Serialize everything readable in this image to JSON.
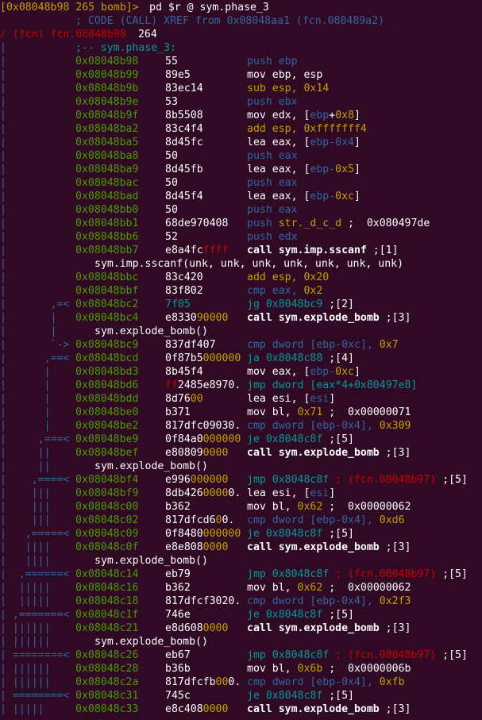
{
  "colors": {
    "background": "#300a24",
    "graph": "#3465a4",
    "address": "#4e9a06",
    "text": "#ffffff",
    "yellow": "#c4a000",
    "blue": "#3465a4",
    "red": "#cc0000",
    "cyan": "#06989a"
  },
  "prompt": {
    "address": "[0x08048b98 265 bomb]> ",
    "command": "pd $r @ sym.phase_3"
  },
  "header": {
    "xref": "; CODE (CALL) XREF from 0x08048aa1 (fcn.080489a2)",
    "fcn_prefix": "/ (fcn) fcn.08048b98",
    "fcn_size": " 264",
    "label": ";-- sym.phase_3:"
  },
  "lines": [
    {
      "graph": "|",
      "address": "0x08048b98",
      "bytes": [
        {
          "t": "55",
          "c": "plain"
        }
      ],
      "mnemonic": [
        {
          "t": "push ebp",
          "c": "blue"
        }
      ]
    },
    {
      "graph": "|",
      "address": "0x08048b99",
      "bytes": [
        {
          "t": "89e5",
          "c": "plain"
        }
      ],
      "mnemonic": [
        {
          "t": "mov ebp, esp",
          "c": "plain"
        }
      ]
    },
    {
      "graph": "|",
      "address": "0x08048b9b",
      "bytes": [
        {
          "t": "83ec14",
          "c": "plain"
        }
      ],
      "mnemonic": [
        {
          "t": "sub esp, ",
          "c": "yel"
        },
        {
          "t": "0x14",
          "c": "yel"
        }
      ]
    },
    {
      "graph": "|",
      "address": "0x08048b9e",
      "bytes": [
        {
          "t": "53",
          "c": "plain"
        }
      ],
      "mnemonic": [
        {
          "t": "push ebx",
          "c": "blue"
        }
      ]
    },
    {
      "graph": "|",
      "address": "0x08048b9f",
      "bytes": [
        {
          "t": "8b5508",
          "c": "plain"
        }
      ],
      "mnemonic": [
        {
          "t": "mov edx, [",
          "c": "plain"
        },
        {
          "t": "ebp",
          "c": "blue"
        },
        {
          "t": "+",
          "c": "plain"
        },
        {
          "t": "0x8",
          "c": "yel"
        },
        {
          "t": "]",
          "c": "plain"
        }
      ]
    },
    {
      "graph": "|",
      "address": "0x08048ba2",
      "bytes": [
        {
          "t": "83c4f4",
          "c": "plain"
        }
      ],
      "mnemonic": [
        {
          "t": "add esp, 0xfffffff4",
          "c": "yel"
        }
      ]
    },
    {
      "graph": "|",
      "address": "0x08048ba5",
      "bytes": [
        {
          "t": "8d45fc",
          "c": "plain"
        }
      ],
      "mnemonic": [
        {
          "t": "lea eax, [",
          "c": "plain"
        },
        {
          "t": "ebp-0x4",
          "c": "blue"
        },
        {
          "t": "]",
          "c": "plain"
        }
      ]
    },
    {
      "graph": "|",
      "address": "0x08048ba8",
      "bytes": [
        {
          "t": "50",
          "c": "plain"
        }
      ],
      "mnemonic": [
        {
          "t": "push eax",
          "c": "blue"
        }
      ]
    },
    {
      "graph": "|",
      "address": "0x08048ba9",
      "bytes": [
        {
          "t": "8d45fb",
          "c": "plain"
        }
      ],
      "mnemonic": [
        {
          "t": "lea eax, [",
          "c": "plain"
        },
        {
          "t": "ebp-",
          "c": "blue"
        },
        {
          "t": "0x5",
          "c": "yel"
        },
        {
          "t": "]",
          "c": "plain"
        }
      ]
    },
    {
      "graph": "|",
      "address": "0x08048bac",
      "bytes": [
        {
          "t": "50",
          "c": "plain"
        }
      ],
      "mnemonic": [
        {
          "t": "push eax",
          "c": "blue"
        }
      ]
    },
    {
      "graph": "|",
      "address": "0x08048bad",
      "bytes": [
        {
          "t": "8d45f4",
          "c": "plain"
        }
      ],
      "mnemonic": [
        {
          "t": "lea eax, [",
          "c": "plain"
        },
        {
          "t": "ebp-",
          "c": "blue"
        },
        {
          "t": "0xc",
          "c": "yel"
        },
        {
          "t": "]",
          "c": "plain"
        }
      ]
    },
    {
      "graph": "|",
      "address": "0x08048bb0",
      "bytes": [
        {
          "t": "50",
          "c": "plain"
        }
      ],
      "mnemonic": [
        {
          "t": "push eax",
          "c": "blue"
        }
      ]
    },
    {
      "graph": "|",
      "address": "0x08048bb1",
      "bytes": [
        {
          "t": "68de970408",
          "c": "plain"
        }
      ],
      "mnemonic": [
        {
          "t": "push ",
          "c": "blue"
        },
        {
          "t": "str._d_c_d",
          "c": "yel"
        },
        {
          "t": " ;  0x080497de",
          "c": "plain"
        }
      ]
    },
    {
      "graph": "|",
      "address": "0x08048bb6",
      "bytes": [
        {
          "t": "52",
          "c": "plain"
        }
      ],
      "mnemonic": [
        {
          "t": "push edx",
          "c": "blue"
        }
      ]
    },
    {
      "graph": "|",
      "address": "0x08048bb7",
      "bytes": [
        {
          "t": "e8a4fc",
          "c": "plain"
        },
        {
          "t": "ffff",
          "c": "red"
        }
      ],
      "mnemonic": [
        {
          "t": "call sym.imp.sscanf",
          "c": "bold"
        },
        {
          "t": " ;[1]",
          "c": "plain"
        }
      ]
    },
    {
      "graph": "|",
      "sub": "sym.imp.sscanf(unk, unk, unk, unk, unk, unk, unk)"
    },
    {
      "graph": "|",
      "address": "0x08048bbc",
      "bytes": [
        {
          "t": "83c420",
          "c": "plain"
        }
      ],
      "mnemonic": [
        {
          "t": "add esp, 0x20",
          "c": "yel"
        }
      ]
    },
    {
      "graph": "|",
      "address": "0x08048bbf",
      "bytes": [
        {
          "t": "83f802",
          "c": "plain"
        }
      ],
      "mnemonic": [
        {
          "t": "cmp eax, ",
          "c": "blue"
        },
        {
          "t": "0x2",
          "c": "yel"
        }
      ]
    },
    {
      "graph": "|       ,=<",
      "address": "0x08048bc2",
      "bytes": [
        {
          "t": "7f05",
          "c": "cyan"
        }
      ],
      "mnemonic": [
        {
          "t": "jg 0x8048bc9",
          "c": "cyan"
        },
        {
          "t": " ;[2]",
          "c": "plain"
        }
      ]
    },
    {
      "graph": "|       |",
      "address": "0x08048bc4",
      "bytes": [
        {
          "t": "e8330",
          "c": "plain"
        },
        {
          "t": "90000",
          "c": "yel"
        }
      ],
      "mnemonic": [
        {
          "t": "call sym.explode_bomb",
          "c": "bold"
        },
        {
          "t": " ;[3]",
          "c": "plain"
        }
      ]
    },
    {
      "graph": "|       |",
      "sub": "sym.explode_bomb()"
    },
    {
      "graph": "|       `->",
      "address": "0x08048bc9",
      "bytes": [
        {
          "t": "837df407",
          "c": "plain"
        }
      ],
      "mnemonic": [
        {
          "t": "cmp dword [",
          "c": "blue"
        },
        {
          "t": "ebp-0xc",
          "c": "blue"
        },
        {
          "t": "], ",
          "c": "blue"
        },
        {
          "t": "0x7",
          "c": "yel"
        }
      ]
    },
    {
      "graph": "|      ,==<",
      "address": "0x08048bcd",
      "bytes": [
        {
          "t": "0f87b5",
          "c": "plain"
        },
        {
          "t": "000000",
          "c": "yel"
        }
      ],
      "mnemonic": [
        {
          "t": "ja 0x8048c88",
          "c": "cyan"
        },
        {
          "t": " ;[4]",
          "c": "plain"
        }
      ]
    },
    {
      "graph": "|      |",
      "address": "0x08048bd3",
      "bytes": [
        {
          "t": "8b45f4",
          "c": "plain"
        }
      ],
      "mnemonic": [
        {
          "t": "mov eax, [",
          "c": "plain"
        },
        {
          "t": "ebp-",
          "c": "blue"
        },
        {
          "t": "0xc",
          "c": "yel"
        },
        {
          "t": "]",
          "c": "plain"
        }
      ]
    },
    {
      "graph": "|      |",
      "address": "0x08048bd6",
      "bytes": [
        {
          "t": "ff",
          "c": "red"
        },
        {
          "t": "2485e8970.",
          "c": "plain"
        }
      ],
      "mnemonic": [
        {
          "t": "jmp dword [eax*4+0x80497e8]",
          "c": "cyan"
        }
      ]
    },
    {
      "graph": "|      |",
      "address": "0x08048bdd",
      "bytes": [
        {
          "t": "8d76",
          "c": "plain"
        },
        {
          "t": "00",
          "c": "yel"
        }
      ],
      "mnemonic": [
        {
          "t": "lea esi, [",
          "c": "plain"
        },
        {
          "t": "esi",
          "c": "blue"
        },
        {
          "t": "]",
          "c": "plain"
        }
      ]
    },
    {
      "graph": "|      |",
      "address": "0x08048be0",
      "bytes": [
        {
          "t": "b371",
          "c": "plain"
        }
      ],
      "mnemonic": [
        {
          "t": "mov bl, ",
          "c": "plain"
        },
        {
          "t": "0x71",
          "c": "yel"
        },
        {
          "t": " ;  0x00000071",
          "c": "plain"
        }
      ]
    },
    {
      "graph": "|      |",
      "address": "0x08048be2",
      "bytes": [
        {
          "t": "817dfc09030.",
          "c": "plain"
        }
      ],
      "mnemonic": [
        {
          "t": "cmp dword [",
          "c": "blue"
        },
        {
          "t": "ebp-0x4",
          "c": "blue"
        },
        {
          "t": "], ",
          "c": "blue"
        },
        {
          "t": "0x309",
          "c": "yel"
        }
      ]
    },
    {
      "graph": "|     ,===<",
      "address": "0x08048be9",
      "bytes": [
        {
          "t": "0f84a0",
          "c": "plain"
        },
        {
          "t": "000000",
          "c": "yel"
        }
      ],
      "mnemonic": [
        {
          "t": "je 0x8048c8f",
          "c": "cyan"
        },
        {
          "t": " ;[5]",
          "c": "plain"
        }
      ]
    },
    {
      "graph": "|     ||",
      "address": "0x08048bef",
      "bytes": [
        {
          "t": "e80809",
          "c": "plain"
        },
        {
          "t": "0000",
          "c": "yel"
        }
      ],
      "mnemonic": [
        {
          "t": "call sym.explode_bomb",
          "c": "bold"
        },
        {
          "t": " ;[3]",
          "c": "plain"
        }
      ]
    },
    {
      "graph": "|     ||",
      "sub": "sym.explode_bomb()"
    },
    {
      "graph": "|    ,====<",
      "address": "0x08048bf4",
      "bytes": [
        {
          "t": "e996",
          "c": "plain"
        },
        {
          "t": "000000",
          "c": "yel"
        }
      ],
      "mnemonic": [
        {
          "t": "jmp 0x8048c8f",
          "c": "cyan"
        },
        {
          "t": " ; (fcn.08048b97)",
          "c": "red"
        },
        {
          "t": " ;[5]",
          "c": "plain"
        }
      ]
    },
    {
      "graph": "|    |||",
      "address": "0x08048bf9",
      "bytes": [
        {
          "t": "8db426",
          "c": "plain"
        },
        {
          "t": "0000",
          "c": "yel"
        },
        {
          "t": "0.",
          "c": "plain"
        }
      ],
      "mnemonic": [
        {
          "t": "lea esi, [",
          "c": "plain"
        },
        {
          "t": "esi",
          "c": "blue"
        },
        {
          "t": "]",
          "c": "plain"
        }
      ]
    },
    {
      "graph": "|    |||",
      "address": "0x08048c00",
      "bytes": [
        {
          "t": "b362",
          "c": "plain"
        }
      ],
      "mnemonic": [
        {
          "t": "mov bl, ",
          "c": "plain"
        },
        {
          "t": "0x62",
          "c": "yel"
        },
        {
          "t": " ;  0x00000062",
          "c": "plain"
        }
      ]
    },
    {
      "graph": "|    |||",
      "address": "0x08048c02",
      "bytes": [
        {
          "t": "817dfcd6",
          "c": "plain"
        },
        {
          "t": "0",
          "c": "yel"
        },
        {
          "t": "0.",
          "c": "plain"
        }
      ],
      "mnemonic": [
        {
          "t": "cmp dword [",
          "c": "blue"
        },
        {
          "t": "ebp-0x4",
          "c": "blue"
        },
        {
          "t": "], ",
          "c": "blue"
        },
        {
          "t": "0xd6",
          "c": "yel"
        }
      ]
    },
    {
      "graph": "|   ,=====<",
      "address": "0x08048c09",
      "bytes": [
        {
          "t": "0f8480",
          "c": "plain"
        },
        {
          "t": "000000",
          "c": "yel"
        }
      ],
      "mnemonic": [
        {
          "t": "je 0x8048c8f",
          "c": "cyan"
        },
        {
          "t": " ;[5]",
          "c": "plain"
        }
      ]
    },
    {
      "graph": "|   ||||",
      "address": "0x08048c0f",
      "bytes": [
        {
          "t": "e8e808",
          "c": "plain"
        },
        {
          "t": "0000",
          "c": "yel"
        }
      ],
      "mnemonic": [
        {
          "t": "call sym.explode_bomb",
          "c": "bold"
        },
        {
          "t": " ;[3]",
          "c": "plain"
        }
      ]
    },
    {
      "graph": "|   ||||",
      "sub": "sym.explode_bomb()"
    },
    {
      "graph": "|  ,======<",
      "address": "0x08048c14",
      "bytes": [
        {
          "t": "eb79",
          "c": "plain"
        }
      ],
      "mnemonic": [
        {
          "t": "jmp 0x8048c8f",
          "c": "cyan"
        },
        {
          "t": " ; (fcn.08048b97)",
          "c": "red"
        },
        {
          "t": " ;[5]",
          "c": "plain"
        }
      ]
    },
    {
      "graph": "|  |||||",
      "address": "0x08048c16",
      "bytes": [
        {
          "t": "b362",
          "c": "plain"
        }
      ],
      "mnemonic": [
        {
          "t": "mov bl, ",
          "c": "plain"
        },
        {
          "t": "0x62",
          "c": "yel"
        },
        {
          "t": " ;  0x00000062",
          "c": "plain"
        }
      ]
    },
    {
      "graph": "|  |||||",
      "address": "0x08048c18",
      "bytes": [
        {
          "t": "817dfcf3020.",
          "c": "plain"
        }
      ],
      "mnemonic": [
        {
          "t": "cmp dword [",
          "c": "blue"
        },
        {
          "t": "ebp-0x4",
          "c": "blue"
        },
        {
          "t": "], ",
          "c": "blue"
        },
        {
          "t": "0x2f3",
          "c": "yel"
        }
      ]
    },
    {
      "graph": "| ,=======<",
      "address": "0x08048c1f",
      "bytes": [
        {
          "t": "746e",
          "c": "plain"
        }
      ],
      "mnemonic": [
        {
          "t": "je 0x8048c8f",
          "c": "cyan"
        },
        {
          "t": " ;[5]",
          "c": "plain"
        }
      ]
    },
    {
      "graph": "| ||||||",
      "address": "0x08048c21",
      "bytes": [
        {
          "t": "e8d608",
          "c": "plain"
        },
        {
          "t": "0000",
          "c": "yel"
        }
      ],
      "mnemonic": [
        {
          "t": "call sym.explode_bomb",
          "c": "bold"
        },
        {
          "t": " ;[3]",
          "c": "plain"
        }
      ]
    },
    {
      "graph": "| ||||||",
      "sub": "sym.explode_bomb()"
    },
    {
      "graph": "| ========<",
      "address": "0x08048c26",
      "bytes": [
        {
          "t": "eb67",
          "c": "plain"
        }
      ],
      "mnemonic": [
        {
          "t": "jmp 0x8048c8f",
          "c": "cyan"
        },
        {
          "t": " ; (fcn.08048b97)",
          "c": "red"
        },
        {
          "t": " ;[5]",
          "c": "plain"
        }
      ]
    },
    {
      "graph": "| ||||||",
      "address": "0x08048c28",
      "bytes": [
        {
          "t": "b36b",
          "c": "plain"
        }
      ],
      "mnemonic": [
        {
          "t": "mov bl, ",
          "c": "plain"
        },
        {
          "t": "0x6b",
          "c": "yel"
        },
        {
          "t": " ;  0x0000006b",
          "c": "plain"
        }
      ]
    },
    {
      "graph": "| ||||||",
      "address": "0x08048c2a",
      "bytes": [
        {
          "t": "817dfcfb",
          "c": "plain"
        },
        {
          "t": "00",
          "c": "yel"
        },
        {
          "t": "0.",
          "c": "plain"
        }
      ],
      "mnemonic": [
        {
          "t": "cmp dword [",
          "c": "blue"
        },
        {
          "t": "ebp-0x4",
          "c": "blue"
        },
        {
          "t": "], ",
          "c": "blue"
        },
        {
          "t": "0xfb",
          "c": "yel"
        }
      ]
    },
    {
      "graph": "| ========<",
      "address": "0x08048c31",
      "bytes": [
        {
          "t": "745c",
          "c": "plain"
        }
      ],
      "mnemonic": [
        {
          "t": "je 0x8048c8f",
          "c": "cyan"
        },
        {
          "t": " ;[5]",
          "c": "plain"
        }
      ]
    },
    {
      "graph": "| |||||",
      "address": "0x08048c33",
      "bytes": [
        {
          "t": "e8c408",
          "c": "plain"
        },
        {
          "t": "0000",
          "c": "yel"
        }
      ],
      "mnemonic": [
        {
          "t": "call sym.explode_bomb",
          "c": "bold"
        },
        {
          "t": " ;[3]",
          "c": "plain"
        }
      ]
    }
  ]
}
